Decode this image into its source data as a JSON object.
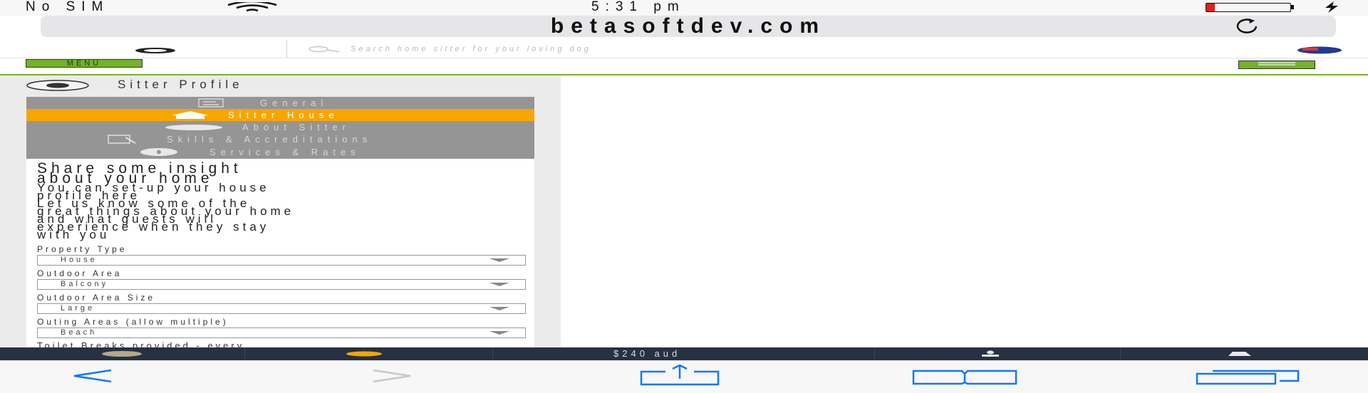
{
  "status_bar": {
    "carrier": "No SIM",
    "time": "5:31 pm"
  },
  "browser": {
    "url": "betasoftdev.com",
    "reload_icon": "reload-icon",
    "toolbar": {
      "back_icon": "back-arrow-icon",
      "forward_icon": "forward-arrow-icon",
      "share_icon": "share-icon",
      "bookmarks_icon": "bookmarks-icon",
      "tabs_icon": "tabs-icon"
    }
  },
  "site": {
    "search_placeholder": "Search home sitter for your loving dog",
    "menu_label": "MENU",
    "flag_icon": "australia-flag-icon",
    "accent_color": "#7ab02b"
  },
  "profile": {
    "title": "Sitter Profile",
    "tabs": [
      {
        "label": "General",
        "active": false,
        "icon": "general-icon"
      },
      {
        "label": "Sitter House",
        "active": true,
        "icon": "house-icon"
      },
      {
        "label": "About Sitter",
        "active": false,
        "icon": "about-icon"
      },
      {
        "label": "Skills & Accreditations",
        "active": false,
        "icon": "skills-icon"
      },
      {
        "label": "Services & Rates",
        "active": false,
        "icon": "services-icon"
      }
    ],
    "heading_lines": [
      "Share some insight",
      "about your home"
    ],
    "intro_lines": [
      "You can set-up your house",
      "profile here",
      "Let us know some of the",
      "great things about your home",
      "and what guests will",
      "experience when they stay",
      "with you"
    ],
    "fields": [
      {
        "label": "Property Type",
        "value": "House"
      },
      {
        "label": "Outdoor Area",
        "value": "Balcony"
      },
      {
        "label": "Outdoor Area Size",
        "value": "Large"
      },
      {
        "label": "Outing Areas (allow multiple)",
        "value": "Beach"
      }
    ],
    "cut_off_label": "Toilet Breaks provided - every"
  },
  "bottom_bar": {
    "price": "$240 aud",
    "colors": {
      "bar": "#263141",
      "dot": "#f7a600"
    }
  }
}
